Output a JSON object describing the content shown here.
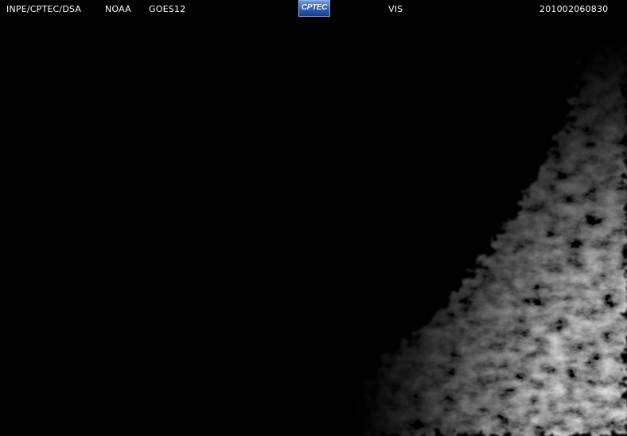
{
  "header": {
    "organization": "INPE/CPTEC/DSA",
    "agency": "NOAA",
    "satellite": "GOES12",
    "channel": "VIS",
    "timestamp": "201002060830"
  },
  "logo": {
    "text": "CPTEC"
  },
  "colors": {
    "background": "#000000",
    "label_text": "#ffffff",
    "logo_blue": "#2a5fb8"
  }
}
